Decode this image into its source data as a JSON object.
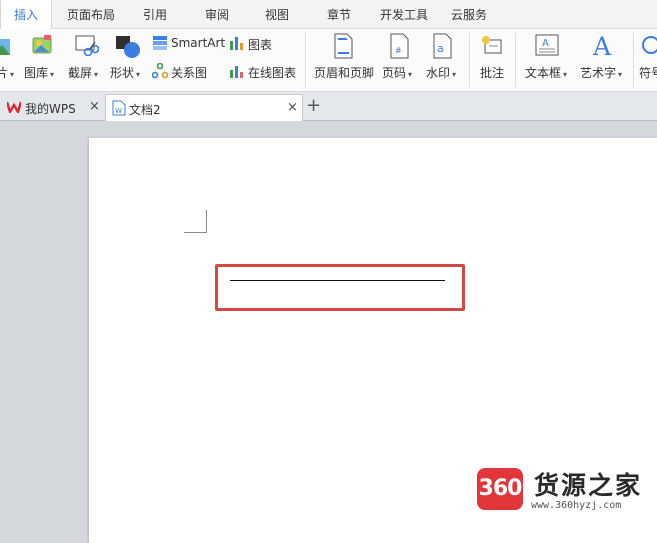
{
  "menu_tabs": [
    {
      "label": "插入",
      "active": true
    },
    {
      "label": "页面布局"
    },
    {
      "label": "引用"
    },
    {
      "label": "审阅"
    },
    {
      "label": "视图"
    },
    {
      "label": "章节"
    },
    {
      "label": "开发工具"
    },
    {
      "label": "云服务"
    }
  ],
  "ribbon": {
    "picture_label": "片",
    "gallery_label": "图库",
    "screenshot_label": "截屏",
    "shapes_label": "形状",
    "smartart_label": "SmartArt",
    "chart_label": "图表",
    "relation_label": "关系图",
    "online_chart_label": "在线图表",
    "header_footer_label": "页眉和页脚",
    "page_number_label": "页码",
    "watermark_label": "水印",
    "comment_label": "批注",
    "textbox_label": "文本框",
    "wordart_label": "艺术字",
    "symbol_label": "符号",
    "dropdown_arrow": "▾"
  },
  "doc_tabs": [
    {
      "label": "我的WPS",
      "close": "×"
    },
    {
      "label": "文档2",
      "close": "×",
      "active": true
    }
  ],
  "new_tab": "+",
  "watermark": {
    "badge": "360",
    "title": "货源之家",
    "url": "www.360hyzj.com"
  },
  "colors": {
    "accent": "#3b7de0",
    "highlight_border": "#d04a44",
    "wps_red": "#d9282f"
  }
}
